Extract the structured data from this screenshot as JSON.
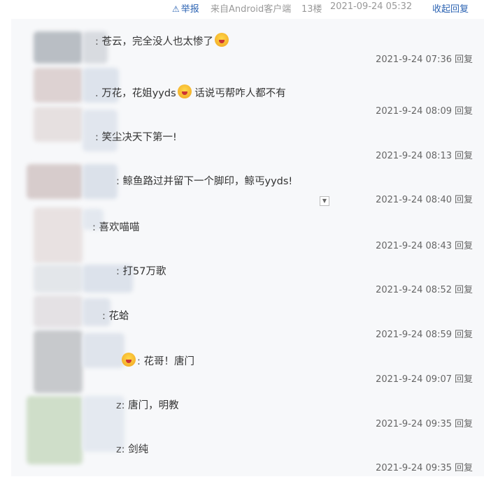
{
  "header": {
    "report_label": "举报",
    "client_label": "来自Android客户端",
    "floor_label": "13楼",
    "post_time": "2021-09-24 05:32",
    "collapse_label": "收起回复"
  },
  "replies": [
    {
      "text": "苍云，完全没人也太惨了",
      "time": "2021-9-24 07:36",
      "reply_label": "回复"
    },
    {
      "text": "万花，花姐yyds",
      "text2": "话说丐帮咋人都不有",
      "time": "2021-9-24 08:09",
      "reply_label": "回复"
    },
    {
      "text": "笑尘决天下第一!",
      "time": "2021-9-24 08:13",
      "reply_label": "回复"
    },
    {
      "text": "鲸鱼路过并留下一个脚印，鲸丐yyds!",
      "time": "2021-9-24 08:40",
      "reply_label": "回复"
    },
    {
      "text": "喜欢喵喵",
      "time": "2021-9-24 08:43",
      "reply_label": "回复"
    },
    {
      "text": "打57万歌",
      "time": "2021-9-24 08:52",
      "reply_label": "回复"
    },
    {
      "text": "花蛤",
      "time": "2021-9-24 08:59",
      "reply_label": "回复"
    },
    {
      "text": "花哥！唐门",
      "time": "2021-9-24 09:07",
      "reply_label": "回复"
    },
    {
      "text": "唐门，明教",
      "time": "2021-9-24 09:35",
      "reply_label": "回复"
    },
    {
      "text": "剑纯",
      "time": "2021-9-24 09:35",
      "reply_label": "回复"
    }
  ]
}
